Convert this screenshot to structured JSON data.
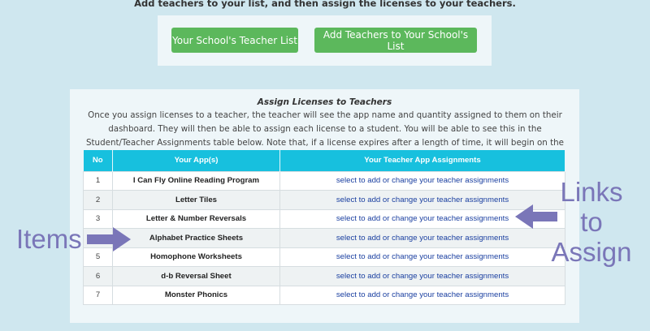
{
  "header": {
    "instruction": "Add teachers to your list, and then assign the licenses to your teachers."
  },
  "buttons": {
    "teacher_list": "Your School's Teacher List",
    "add_teachers": "Add Teachers to Your School's List"
  },
  "assign": {
    "title": "Assign Licenses to Teachers",
    "description": "Once you assign licenses to a teacher, the teacher will see the app name and quantity assigned to them on their dashboard. They will then be able to assign each license to a student. You will be able to see this in the Student/Teacher Assignments table below. Note that, if a license expires after a length of time, it will begin on the date the student is assigned."
  },
  "table": {
    "headers": [
      "No",
      "Your App(s)",
      "Your Teacher App Assignments"
    ],
    "rows": [
      {
        "no": "1",
        "app": "I Can Fly Online Reading Program",
        "link": "select to add or change your teacher assignments"
      },
      {
        "no": "2",
        "app": "Letter Tiles",
        "link": "select to add or change your teacher assignments"
      },
      {
        "no": "3",
        "app": "Letter & Number Reversals",
        "link": "select to add or change your teacher assignments"
      },
      {
        "no": "4",
        "app": "Alphabet Practice Sheets",
        "link": "select to add or change your teacher assignments"
      },
      {
        "no": "5",
        "app": "Homophone Worksheets",
        "link": "select to add or change your teacher assignments"
      },
      {
        "no": "6",
        "app": "d-b Reversal Sheet",
        "link": "select to add or change your teacher assignments"
      },
      {
        "no": "7",
        "app": "Monster Phonics",
        "link": "select to add or change your teacher assignments"
      }
    ]
  },
  "annotations": {
    "items_label": "Items",
    "links_label": "Links to Assign",
    "color": "#7a76b8"
  },
  "colors": {
    "page_background": "#cfe7ef",
    "button_green": "#5cb85c",
    "table_header": "#17c0de",
    "link": "#1a3fa0"
  },
  "icons": [
    "arrow-right-icon",
    "arrow-left-icon"
  ]
}
